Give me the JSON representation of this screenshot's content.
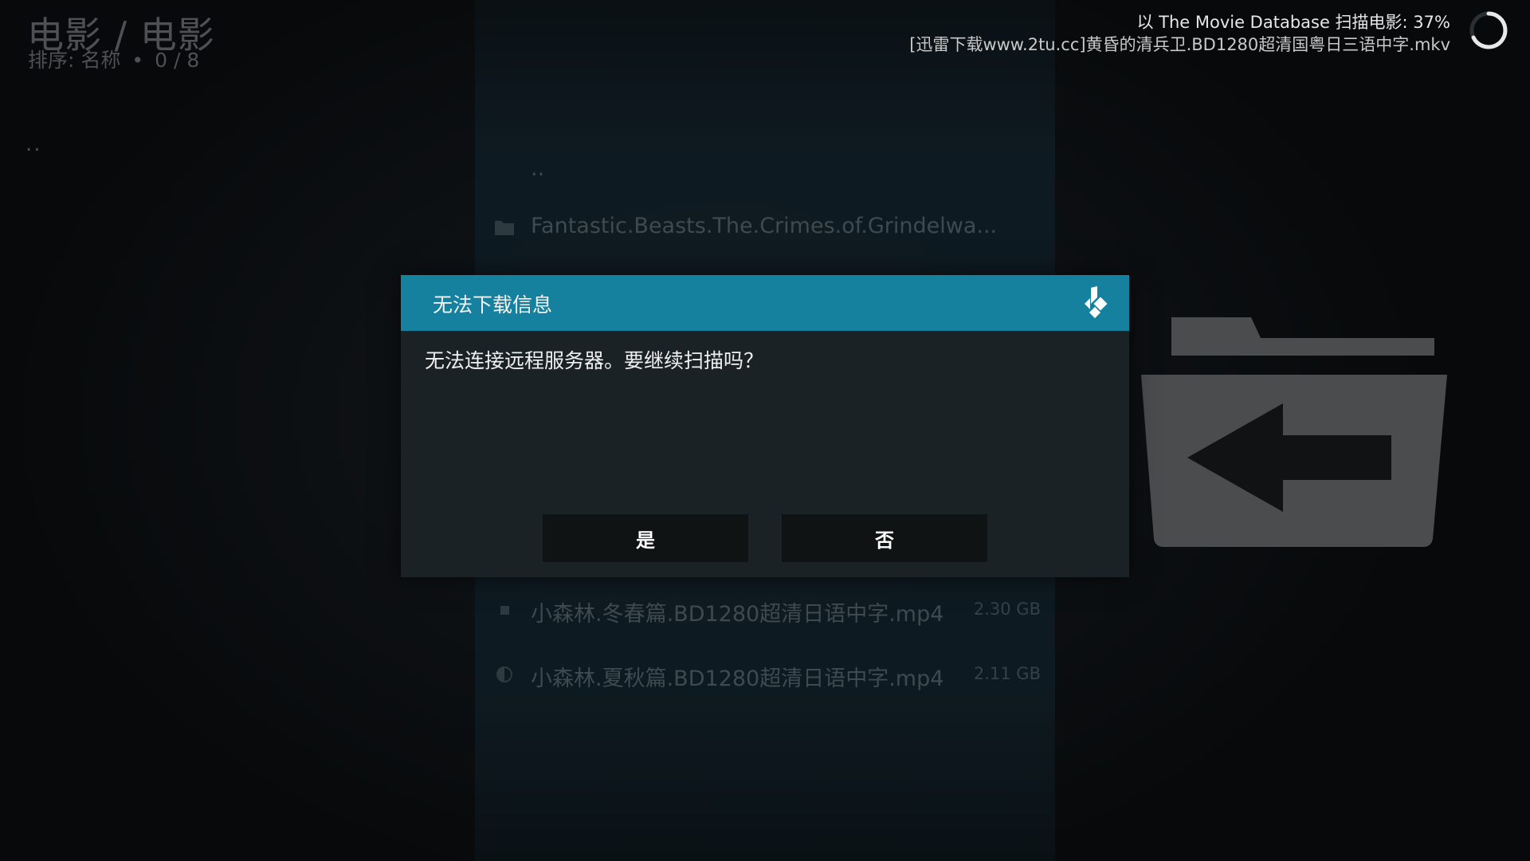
{
  "header": {
    "title": "电影 / 电影",
    "sort_label": "排序: 名称",
    "separator": "•",
    "count": "0 / 8"
  },
  "left_list": {
    "parent_item": ".."
  },
  "scan_status": {
    "line1": "以 The Movie Database 扫描电影: 37%",
    "line2": "[迅雷下载www.2tu.cc]黄昏的清兵卫.BD1280超清国粤日三语中字.mkv",
    "progress_percent": 37
  },
  "file_list": {
    "items": [
      {
        "label": "..",
        "size": "",
        "icon": "none"
      },
      {
        "label": "Fantastic.Beasts.The.Crimes.of.Grindelwa...",
        "size": "",
        "icon": "folder-icon"
      },
      {
        "label": "小森林.冬春篇.BD1280超清日语中字.mp4",
        "size": "2.30 GB",
        "icon": "square-icon"
      },
      {
        "label": "小森林.夏秋篇.BD1280超清日语中字.mp4",
        "size": "2.11 GB",
        "icon": "half-circle-icon"
      }
    ]
  },
  "dialog": {
    "title": "无法下载信息",
    "message": "无法连接远程服务器。要继续扫描吗？",
    "yes_label": "是",
    "no_label": "否"
  },
  "colors": {
    "dialog_header": "#16809f",
    "dialog_body": "#1b2226",
    "button_bg": "#101314",
    "dim_text": "#4d5154"
  }
}
